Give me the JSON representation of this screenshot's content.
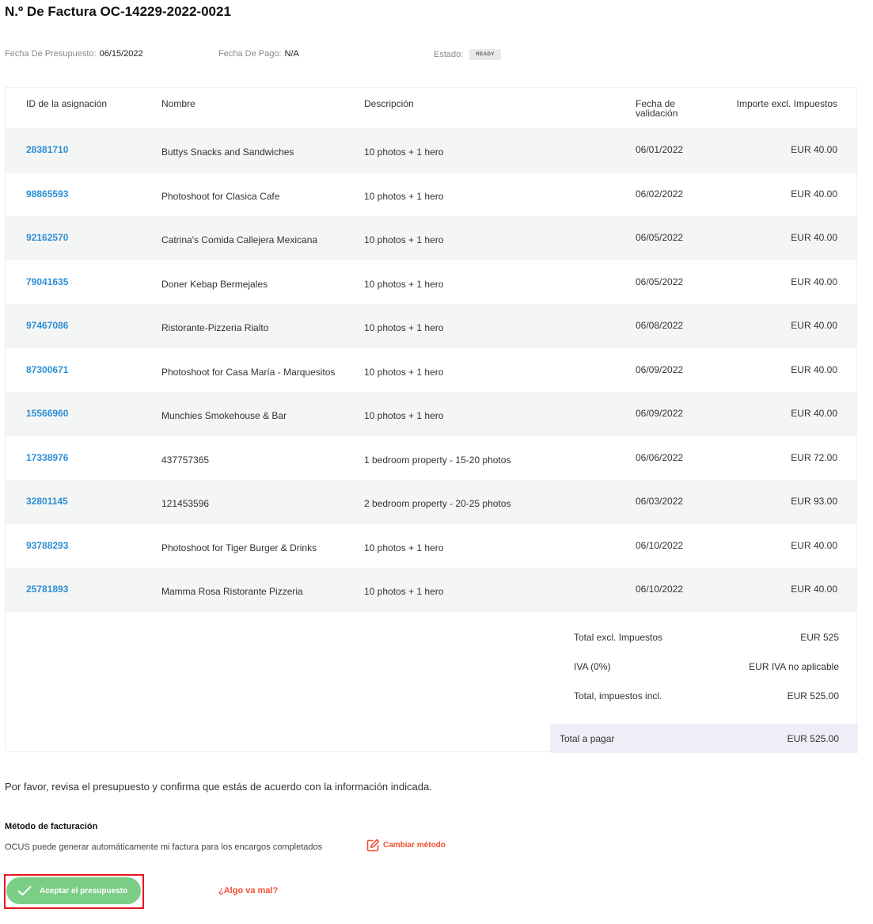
{
  "header": {
    "title": "N.º De Factura OC-14229-2022-0021"
  },
  "meta": {
    "budget_date_label": "Fecha De Presupuesto:",
    "budget_date": "06/15/2022",
    "payment_date_label": "Fecha De Pago:",
    "payment_date": "N/A",
    "status_label": "Estado:",
    "status": "READY"
  },
  "table": {
    "headers": {
      "id": "ID de la asignación",
      "name": "Nombre",
      "description": "Descripción",
      "validation_date_1": "Fecha de",
      "validation_date_2": "validación",
      "amount": "Importe excl. Impuestos"
    },
    "rows": [
      {
        "id": "28381710",
        "name": "Buttys Snacks and Sandwiches",
        "description": "10 photos + 1 hero",
        "date": "06/01/2022",
        "amount": "EUR 40.00"
      },
      {
        "id": "98865593",
        "name": "Photoshoot for Clasica Cafe",
        "description": "10 photos + 1 hero",
        "date": "06/02/2022",
        "amount": "EUR 40.00"
      },
      {
        "id": "92162570",
        "name": "Catrina's Comida Callejera Mexicana",
        "description": "10 photos + 1 hero",
        "date": "06/05/2022",
        "amount": "EUR 40.00"
      },
      {
        "id": "79041635",
        "name": "Doner Kebap Bermejales",
        "description": "10 photos + 1 hero",
        "date": "06/05/2022",
        "amount": "EUR 40.00"
      },
      {
        "id": "97467086",
        "name": "Ristorante-Pizzeria Rialto",
        "description": "10 photos + 1 hero",
        "date": "06/08/2022",
        "amount": "EUR 40.00"
      },
      {
        "id": "87300671",
        "name": "Photoshoot for Casa María - Marquesitos",
        "description": "10 photos + 1 hero",
        "date": "06/09/2022",
        "amount": "EUR 40.00"
      },
      {
        "id": "15566960",
        "name": "Munchies Smokehouse & Bar",
        "description": "10 photos + 1 hero",
        "date": "06/09/2022",
        "amount": "EUR 40.00"
      },
      {
        "id": "17338976",
        "name": "437757365",
        "description": "1 bedroom property - 15-20 photos",
        "date": "06/06/2022",
        "amount": "EUR 72.00"
      },
      {
        "id": "32801145",
        "name": "121453596",
        "description": "2 bedroom property - 20-25 photos",
        "date": "06/03/2022",
        "amount": "EUR 93.00"
      },
      {
        "id": "93788293",
        "name": "Photoshoot for Tiger Burger & Drinks",
        "description": "10 photos + 1 hero",
        "date": "06/10/2022",
        "amount": "EUR 40.00"
      },
      {
        "id": "25781893",
        "name": "Mamma Rosa Ristorante Pizzeria",
        "description": "10 photos + 1 hero",
        "date": "06/10/2022",
        "amount": "EUR 40.00"
      }
    ]
  },
  "summary": {
    "subtotal_label": "Total excl. Impuestos",
    "subtotal": "EUR 525",
    "vat_label": "IVA (0%)",
    "vat": "EUR IVA no aplicable",
    "total_incl_label": "Total, impuestos incl.",
    "total_incl": "EUR 525.00",
    "to_pay_label": "Total a pagar",
    "to_pay": "EUR 525.00"
  },
  "footer": {
    "note": "Por favor, revisa el presupuesto y confirma que estás de acuerdo con la información indicada.",
    "billing_title": "Método de facturación",
    "billing_text": "OCUS puede generar automáticamente mi factura para los encargos completados",
    "change_method": "Cambiar método",
    "accept": "Aceptar el presupuesto",
    "something_wrong": "¿Algo va mal?"
  },
  "colors": {
    "link_blue": "#2d8fd6",
    "accent_orange": "#f24f2e",
    "accept_green": "#7bce86",
    "highlight_red": "#e3161e"
  }
}
